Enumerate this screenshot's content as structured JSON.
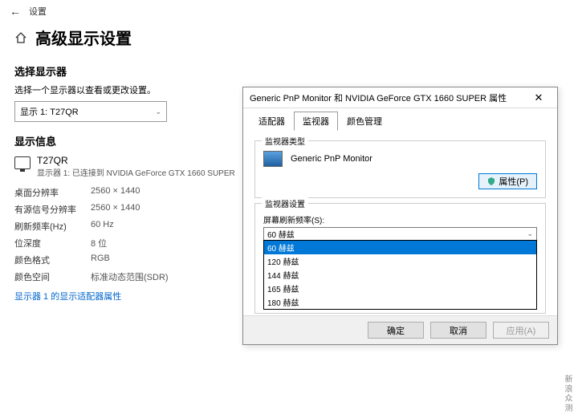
{
  "top": {
    "settings": "设置"
  },
  "page": {
    "title": "高级显示设置"
  },
  "selector": {
    "heading": "选择显示器",
    "desc": "选择一个显示器以查看或更改设置。",
    "value": "显示 1: T27QR"
  },
  "info": {
    "heading": "显示信息",
    "monitor_name": "T27QR",
    "monitor_sub": "显示器 1: 已连接到 NVIDIA GeForce GTX 1660 SUPER",
    "rows": [
      {
        "k": "桌面分辨率",
        "v": "2560 × 1440"
      },
      {
        "k": "有源信号分辨率",
        "v": "2560 × 1440"
      },
      {
        "k": "刷新频率(Hz)",
        "v": "60 Hz"
      },
      {
        "k": "位深度",
        "v": "8 位"
      },
      {
        "k": "颜色格式",
        "v": "RGB"
      },
      {
        "k": "颜色空间",
        "v": "标准动态范围(SDR)"
      }
    ],
    "link": "显示器 1 的显示适配器属性"
  },
  "dialog": {
    "title": "Generic PnP Monitor 和 NVIDIA GeForce GTX 1660 SUPER 属性",
    "tabs": [
      "适配器",
      "监视器",
      "颜色管理"
    ],
    "active_tab": 1,
    "group_type": "监视器类型",
    "monitor_type": "Generic PnP Monitor",
    "prop_btn": "属性(P)",
    "group_settings": "监视器设置",
    "refresh_label": "屏幕刷新频率(S):",
    "dd_value": "60 赫兹",
    "dd_options": [
      "60 赫兹",
      "120 赫兹",
      "144 赫兹",
      "165 赫兹",
      "180 赫兹"
    ],
    "dd_selected": 0,
    "buttons": {
      "ok": "确定",
      "cancel": "取消",
      "apply": "应用(A)"
    }
  },
  "watermark": "新浪众测"
}
